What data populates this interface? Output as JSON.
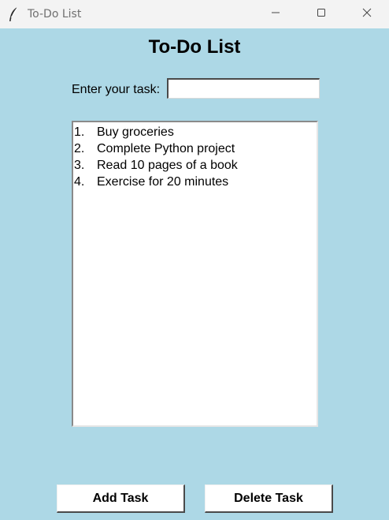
{
  "window": {
    "title": "To-Do List",
    "icon": "feather-icon",
    "controls": [
      "minimize-icon",
      "maximize-icon",
      "close-icon"
    ]
  },
  "main": {
    "heading": "To-Do List",
    "entry_label": "Enter your task:",
    "entry_value": "",
    "tasks": [
      {
        "number": "1.",
        "text": "Buy groceries"
      },
      {
        "number": "2.",
        "text": "Complete Python project"
      },
      {
        "number": "3.",
        "text": "Read 10 pages of a book"
      },
      {
        "number": "4.",
        "text": "Exercise for 20 minutes"
      }
    ]
  },
  "buttons": {
    "add_label": "Add Task",
    "delete_label": "Delete Task"
  },
  "colors": {
    "background": "#add8e6",
    "titlebar": "#f3f3f3"
  }
}
